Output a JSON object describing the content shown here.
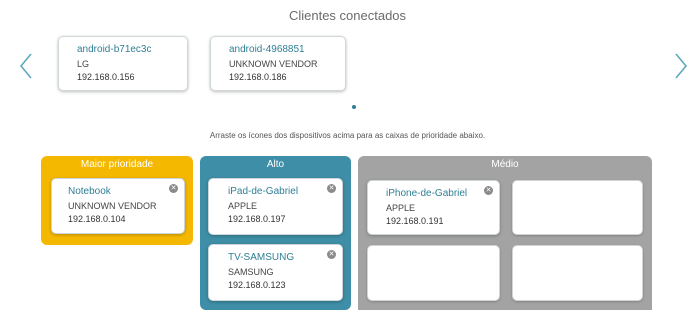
{
  "header": {
    "title": "Clientes conectados"
  },
  "connected_clients": [
    {
      "name": "android-b71ec3c",
      "vendor": "LG",
      "ip": "192.168.0.156"
    },
    {
      "name": "android-4968851",
      "vendor": "UNKNOWN VENDOR",
      "ip": "192.168.0.186"
    }
  ],
  "hint": "Arraste os ícones dos dispositivos acima para as caixas de prioridade abaixo.",
  "zones": {
    "highest": {
      "label": "Maior prioridade",
      "devices": [
        {
          "name": "Notebook",
          "vendor": "UNKNOWN VENDOR",
          "ip": "192.168.0.104"
        }
      ]
    },
    "high": {
      "label": "Alto",
      "devices": [
        {
          "name": "iPad-de-Gabriel",
          "vendor": "APPLE",
          "ip": "192.168.0.197"
        },
        {
          "name": "TV-SAMSUNG",
          "vendor": "SAMSUNG",
          "ip": "192.168.0.123"
        }
      ]
    },
    "medium": {
      "label": "Médio",
      "devices": [
        {
          "name": "iPhone-de-Gabriel",
          "vendor": "APPLE",
          "ip": "192.168.0.191"
        }
      ]
    }
  },
  "icons": {
    "prev": "chevron-left-icon",
    "next": "chevron-right-icon",
    "remove": "close-icon"
  },
  "colors": {
    "highest": "#f5b800",
    "high": "#3e8ea7",
    "medium": "#a3a3a3",
    "accent": "#2f7f96"
  }
}
